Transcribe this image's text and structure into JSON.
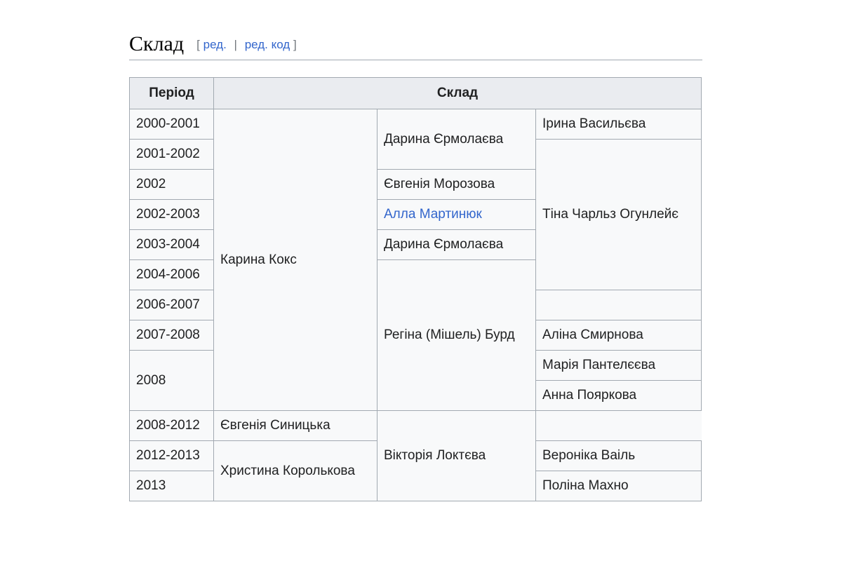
{
  "section": {
    "title": "Склад",
    "edit_open": "[",
    "edit_label": "ред.",
    "edit_sep": "|",
    "edit_code_label": "ред. код",
    "edit_close": "]"
  },
  "table": {
    "headers": {
      "period": "Період",
      "lineup": "Склад"
    },
    "periods": [
      "2000-2001",
      "2001-2002",
      "2002",
      "2002-2003",
      "2003-2004",
      "2004-2006",
      "2006-2007",
      "2007-2008",
      "2008",
      "2008-2012",
      "2012-2013",
      "2013"
    ],
    "col2": [
      "Карина Кокс",
      "Христина Королькова"
    ],
    "col3": [
      "Дарина Єрмолаєва",
      "Євгенія Морозова",
      "Алла Мартинюк",
      "Дарина Єрмолаєва",
      "Регіна (Мішель) Бурд",
      "Євгенія Синицька",
      "Вероніка Ваіль",
      "Поліна Махно"
    ],
    "col4": [
      "Ірина Васильєва",
      "Тіна Чарльз Огунлейє",
      "",
      "Аліна Смирнова",
      "Марія Пантелєєва",
      "Анна Пояркова",
      "Вікторія Локтєва"
    ]
  }
}
